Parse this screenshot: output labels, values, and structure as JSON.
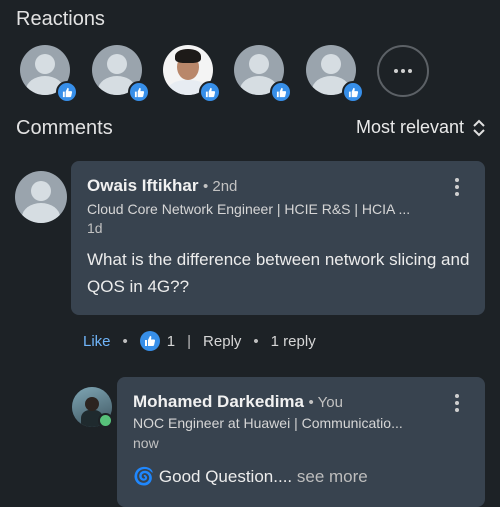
{
  "reactions": {
    "title": "Reactions",
    "items": [
      {
        "avatar": "generic-avatar",
        "reaction_icon": "like-icon"
      },
      {
        "avatar": "generic-avatar",
        "reaction_icon": "like-icon"
      },
      {
        "avatar": "photo-avatar",
        "reaction_icon": "like-icon"
      },
      {
        "avatar": "generic-avatar",
        "reaction_icon": "like-icon"
      },
      {
        "avatar": "generic-avatar",
        "reaction_icon": "like-icon"
      }
    ],
    "more_icon": "more-horizontal-icon"
  },
  "comments": {
    "title": "Comments",
    "sort_label": "Most relevant",
    "sort_icon": "chevron-up-down-icon",
    "list": [
      {
        "author": "Owais Iftikhar",
        "degree": "• 2nd",
        "headline": "Cloud Core Network Engineer | HCIE R&S | HCIA ...",
        "time": "1d",
        "text": "What is the difference between network slicing and QOS in 4G??",
        "actions": {
          "like": "Like",
          "like_count": "1",
          "reply": "Reply",
          "replies": "1 reply"
        }
      },
      {
        "author": "Mohamed Darkedima",
        "degree": "• You",
        "headline": "NOC Engineer at Huawei | Communicatio...",
        "time": "now",
        "text": "🌀 Good Question....",
        "see_more": "see more"
      }
    ]
  },
  "colors": {
    "background": "#1d2226",
    "bubble": "#38434f",
    "accent": "#70b5f9",
    "like_badge": "#378fe9",
    "online": "#57c27a"
  }
}
